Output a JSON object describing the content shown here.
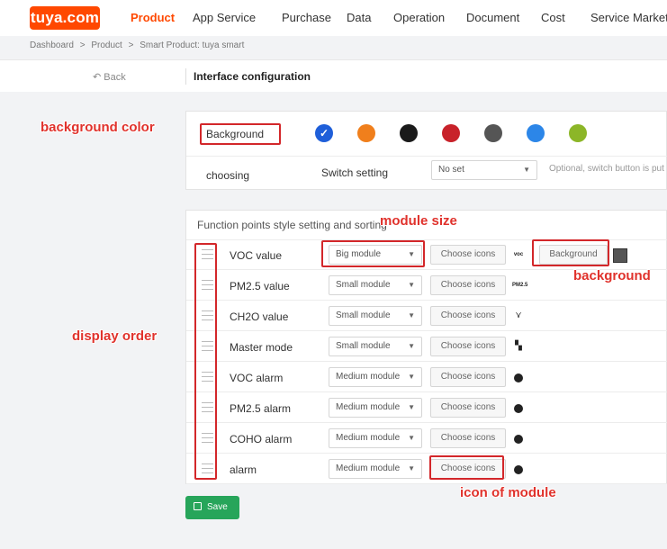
{
  "nav": {
    "logo": "tuya.com",
    "items": [
      "Product",
      "App Service",
      "Purchase",
      "Data",
      "Operation",
      "Document",
      "Cost",
      "Service Market"
    ]
  },
  "breadcrumb": [
    "Dashboard",
    ">",
    "Product",
    ">",
    "Smart Product: tuya smart"
  ],
  "header": {
    "back": "Back",
    "title": "Interface configuration"
  },
  "background_panel": {
    "label": "Background",
    "swatches": [
      "#1f5fd9",
      "#f07f1c",
      "#1a1a1a",
      "#c8222a",
      "#555555",
      "#2c86e8",
      "#8cb628"
    ],
    "choosing": "choosing",
    "switch_label": "Switch setting",
    "switch_value": "No set",
    "switch_hint": "Optional, switch button is put o"
  },
  "function_panel": {
    "title": "Function points style setting and sorting",
    "choose_label": "Choose icons",
    "background_label": "Background",
    "rows": [
      {
        "name": "VOC value",
        "module": "Big module",
        "icon": "voc-icon",
        "icon_text": "voc"
      },
      {
        "name": "PM2.5 value",
        "module": "Small module",
        "icon": "pm25-icon",
        "icon_text": "PM2.5"
      },
      {
        "name": "CH2O value",
        "module": "Small module",
        "icon": "molecule-icon",
        "icon_text": "⋎"
      },
      {
        "name": "Master mode",
        "module": "Small module",
        "icon": "grid-icon",
        "icon_text": "▚"
      },
      {
        "name": "VOC alarm",
        "module": "Medium module",
        "icon": "face-icon",
        "icon_text": ""
      },
      {
        "name": "PM2.5 alarm",
        "module": "Medium module",
        "icon": "face-icon",
        "icon_text": ""
      },
      {
        "name": "COHO alarm",
        "module": "Medium module",
        "icon": "face-icon",
        "icon_text": ""
      },
      {
        "name": "alarm",
        "module": "Medium module",
        "icon": "face-icon",
        "icon_text": ""
      }
    ]
  },
  "save_label": "Save",
  "annotations": {
    "background_color": "background color",
    "module_size": "module size",
    "background": "background",
    "display_order": "display order",
    "icon_of_module": "icon of module"
  },
  "colors": {
    "accent": "#ff4800",
    "save": "#27a55a",
    "annotation": "#e0322c"
  }
}
